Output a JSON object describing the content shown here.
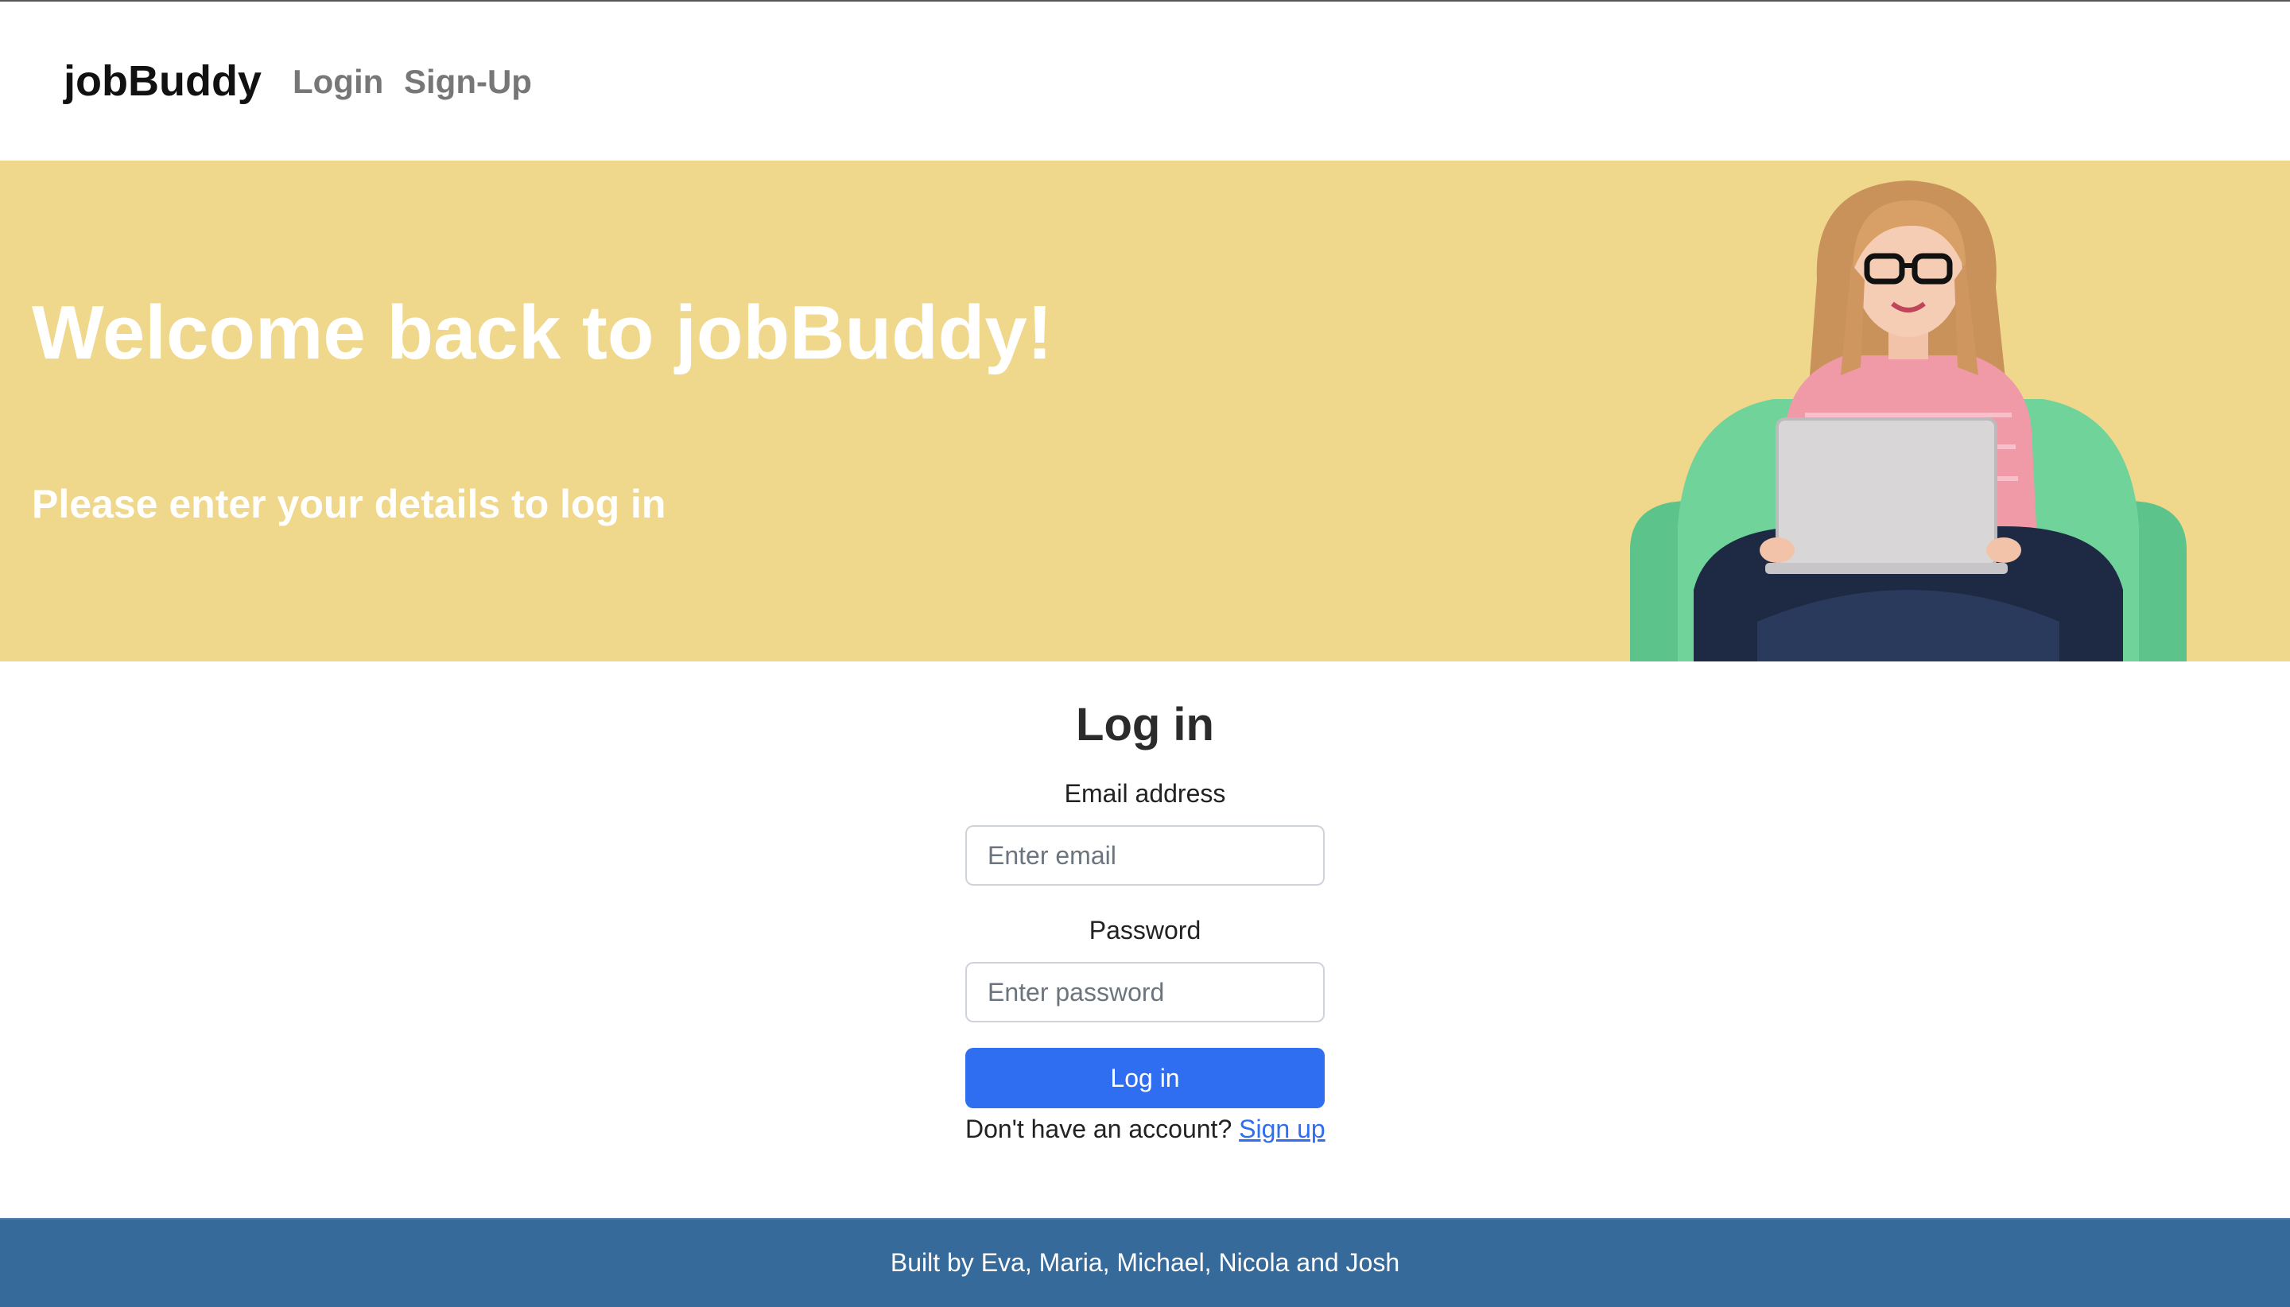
{
  "navbar": {
    "brand": "jobBuddy",
    "links": [
      "Login",
      "Sign-Up"
    ]
  },
  "hero": {
    "title": "Welcome back to jobBuddy!",
    "subtitle": "Please enter your details to log in",
    "background_color": "#efd88c",
    "illustration": "person-with-laptop-in-armchair"
  },
  "login": {
    "title": "Log in",
    "email_label": "Email address",
    "email_placeholder": "Enter email",
    "email_value": "",
    "password_label": "Password",
    "password_placeholder": "Enter password",
    "password_value": "",
    "button_label": "Log in",
    "signup_prompt": "Don't have an account?",
    "signup_link": "Sign up",
    "accent_color": "#2f6ef0"
  },
  "footer": {
    "text": "Built by Eva, Maria, Michael, Nicola and Josh",
    "background_color": "#356a9a"
  }
}
